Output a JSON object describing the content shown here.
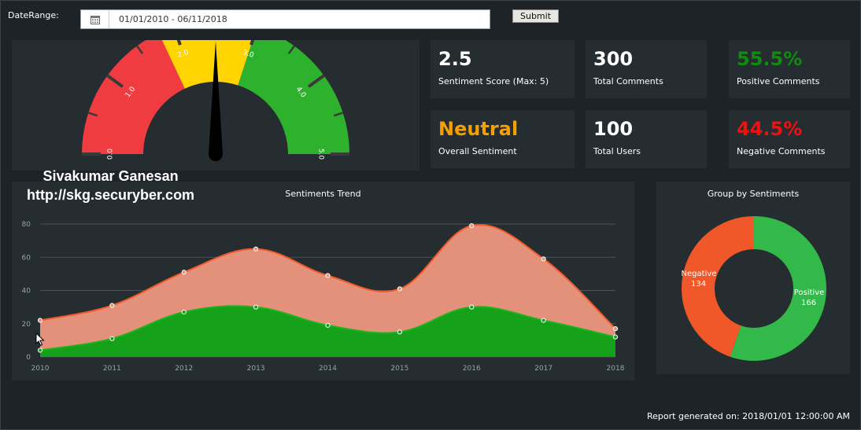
{
  "header": {
    "date_range_label": "DateRange:",
    "date_range_value": "01/01/2010 - 06/11/2018",
    "submit_label": "Submit",
    "calendar_icon": "calendar-icon"
  },
  "gauge": {
    "value": 2.5,
    "max": 5,
    "ticks": [
      "0.0",
      "1.0",
      "2.0",
      "3.0",
      "4.0",
      "5.0"
    ],
    "bands": [
      {
        "from": 0,
        "to": 1.8,
        "color": "#f03c41"
      },
      {
        "from": 1.8,
        "to": 3.0,
        "color": "#ffd400"
      },
      {
        "from": 3.0,
        "to": 5.0,
        "color": "#2eb22e"
      }
    ]
  },
  "kpis": {
    "sentiment_score": {
      "value": "2.5",
      "label": "Sentiment Score (Max: 5)",
      "color": "#ffffff"
    },
    "total_comments": {
      "value": "300",
      "label": "Total Comments",
      "color": "#ffffff"
    },
    "positive_comments": {
      "value": "55.5%",
      "label": "Positive Comments",
      "color": "#118a11"
    },
    "overall_sentiment": {
      "value": "Neutral",
      "label": "Overall Sentiment",
      "color": "#f5a000"
    },
    "total_users": {
      "value": "100",
      "label": "Total Users",
      "color": "#ffffff"
    },
    "negative_comments": {
      "value": "44.5%",
      "label": "Negative Comments",
      "color": "#f01010"
    }
  },
  "watermark": {
    "name": "Sivakumar Ganesan",
    "url": "http://skg.securyber.com"
  },
  "chart_data": [
    {
      "type": "area",
      "title": "Sentiments Trend",
      "x": [
        "2010",
        "2011",
        "2012",
        "2013",
        "2014",
        "2015",
        "2016",
        "2017",
        "2018"
      ],
      "series": [
        {
          "color": "#e3917a",
          "line": "#f05a28",
          "values": [
            22,
            31,
            51,
            65,
            49,
            41,
            79,
            59,
            17
          ]
        },
        {
          "color": "#16a11a",
          "line": "#1db31d",
          "values": [
            4,
            11,
            27,
            30,
            19,
            15,
            30,
            22,
            12
          ]
        }
      ],
      "ylim": [
        0,
        80
      ],
      "yticks": [
        "0",
        "20",
        "40",
        "60",
        "80"
      ],
      "grid": true
    },
    {
      "type": "pie",
      "title": "Group by Sentiments",
      "slices": [
        {
          "label": "Positive",
          "value": 166,
          "color": "#33b94a"
        },
        {
          "label": "Negative",
          "value": 134,
          "color": "#f0582a"
        }
      ],
      "donut": true
    }
  ],
  "footer": {
    "report_generated": "Report generated on: 2018/01/01 12:00:00 AM"
  },
  "colors": {
    "background": "#1d2327",
    "panel": "#252d31",
    "gridline": "#4a5459",
    "axis_text": "#9aa3a8"
  }
}
